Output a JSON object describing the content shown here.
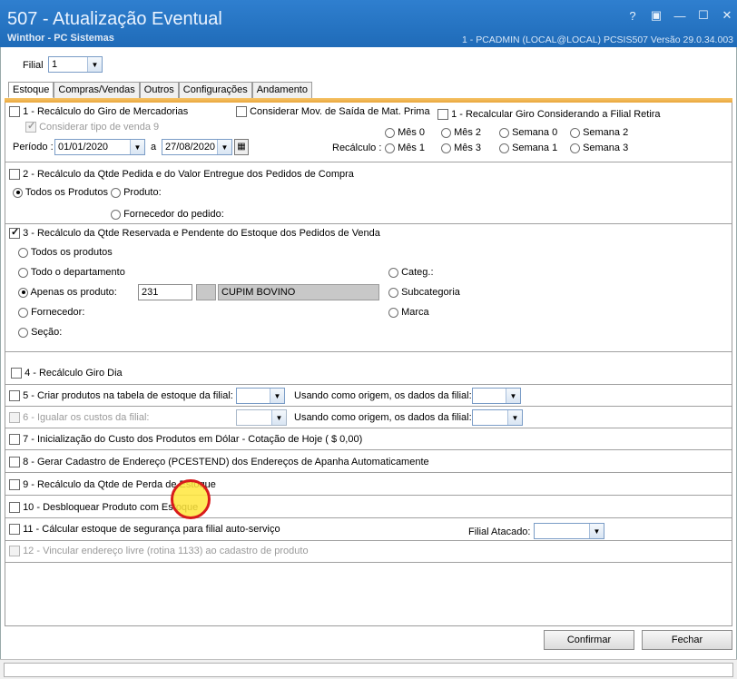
{
  "window": {
    "title": "507 - Atualização Eventual",
    "subtitle": "Winthor - PC Sistemas",
    "session": "1 - PCADMIN (LOCAL@LOCAL)   PCSIS507  Versão  29.0.34.003"
  },
  "filial": {
    "label": "Filial",
    "value": "1"
  },
  "tabs": [
    "Estoque",
    "Compras/Vendas",
    "Outros",
    "Configurações",
    "Andamento"
  ],
  "section1": {
    "recalc_giro": "1 - Recálculo do Giro de Mercadorias",
    "considerar_tipo": "Considerar tipo de venda 9",
    "considerar_mov": "Considerar Mov. de Saída de Mat. Prima",
    "recalcular_giro_filial": "1 - Recalcular Giro Considerando a Filial Retira",
    "periodo_label": "Período :",
    "date_from": "01/01/2020",
    "a_label": "a",
    "date_to": "27/08/2020",
    "recalculo_label": "Recálculo :",
    "radios": [
      "Mês 0",
      "Mês 2",
      "Semana 0",
      "Semana 2",
      "Mês 1",
      "Mês 3",
      "Semana 1",
      "Semana 3"
    ]
  },
  "section2": {
    "title": "2 - Recálculo da Qtde Pedida e do Valor Entregue dos Pedidos de Compra",
    "todos": "Todos os Produtos",
    "produto": "Produto:",
    "fornecedor": "Fornecedor do pedido:"
  },
  "section3": {
    "title": "3 - Recálculo da Qtde Reservada e Pendente do Estoque dos Pedidos de Venda",
    "todos": "Todos os produtos",
    "departamento": "Todo o departamento",
    "apenas": "Apenas os produto:",
    "product_code": "231",
    "product_name": "CUPIM BOVINO",
    "fornecedor": "Fornecedor:",
    "secao": "Seção:",
    "categ": "Categ.:",
    "subcategoria": "Subcategoria",
    "marca": "Marca"
  },
  "items": {
    "i4": "4 - Recálculo Giro Dia",
    "i5": "5 - Criar produtos na tabela de estoque da filial:",
    "i5_origem": "Usando como origem, os dados da filial:",
    "i6": "6 - Igualar os custos da filial:",
    "i6_origem": "Usando como origem, os dados da filial:",
    "i7": "7 - Inicialização do Custo dos Produtos em Dólar - Cotação de Hoje ( $ 0,00)",
    "i8": "8 - Gerar Cadastro de Endereço (PCESTEND) dos Endereços de Apanha Automaticamente",
    "i9": "9 - Recálculo da Qtde de Perda de Estoque",
    "i10": "10 - Desbloquear Produto com Estoque",
    "i11": "11 - Cálcular estoque de segurança para filial auto-serviço",
    "filial_atacado": "Filial Atacado:",
    "i12": "12 - Vincular endereço livre (rotina 1133) ao cadastro de produto"
  },
  "buttons": {
    "confirmar": "Confirmar",
    "fechar": "Fechar"
  },
  "icons": [
    "help-icon",
    "restore-icon",
    "minimize-icon",
    "maximize-icon",
    "close-icon",
    "calendar-icon",
    "dropdown-arrow-icon"
  ],
  "colors": {
    "titlebar": "#1f6bb8",
    "tab_accent": "#e9a63d",
    "cursor_highlight": "#d81b1b"
  }
}
